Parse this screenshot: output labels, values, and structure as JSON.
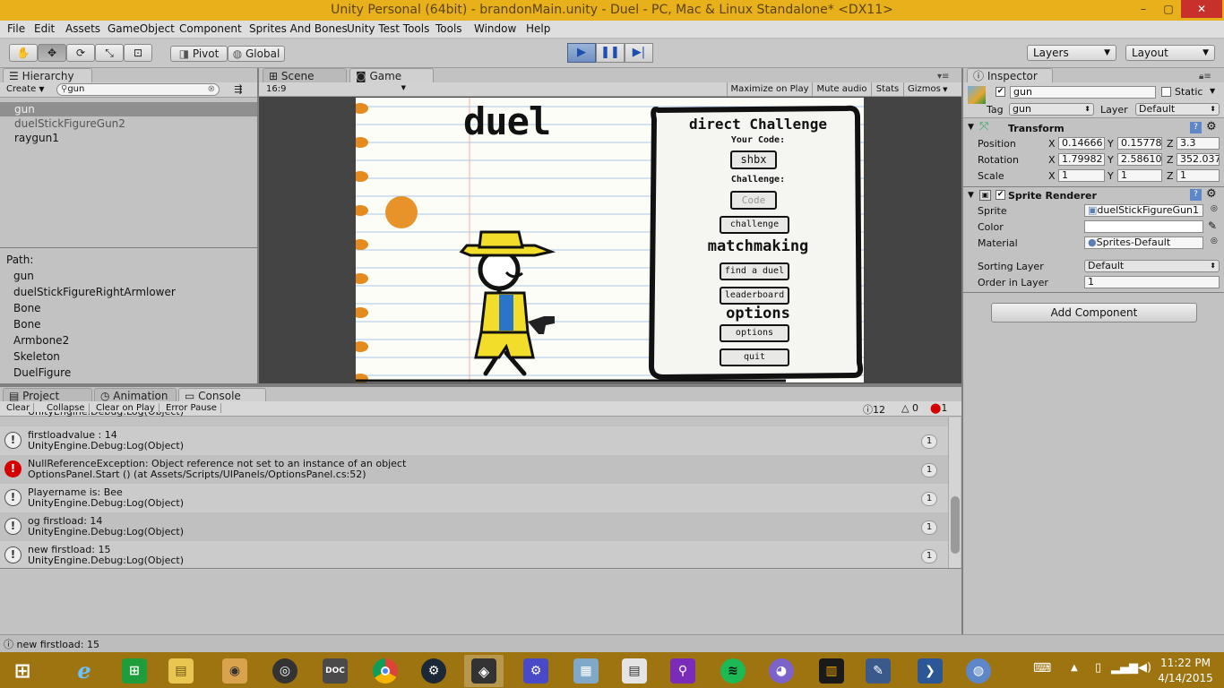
{
  "window": {
    "title": "Unity Personal (64bit) - brandonMain.unity - Duel - PC, Mac & Linux Standalone* <DX11>",
    "minimize": "–",
    "maximize": "▢",
    "close": "✕"
  },
  "menu": [
    "File",
    "Edit",
    "Assets",
    "GameObject",
    "Component",
    "Sprites And Bones",
    "Unity Test Tools",
    "Tools",
    "Window",
    "Help"
  ],
  "toolbar": {
    "pivot": "Pivot",
    "global": "Global",
    "layers": "Layers",
    "layout": "Layout"
  },
  "hierarchy": {
    "tab": "Hierarchy",
    "create": "Create",
    "search": "gun",
    "items": [
      "gun",
      "duelStickFigureGun2",
      "raygun1"
    ],
    "path_label": "Path:",
    "path": [
      "gun",
      "duelStickFigureRightArmlower",
      "Bone",
      "Bone",
      "Armbone2",
      "Skeleton",
      "DuelFigure"
    ]
  },
  "scene": {
    "tab_scene": "Scene",
    "tab_game": "Game",
    "aspect": "16:9",
    "maximize": "Maximize on Play",
    "mute": "Mute audio",
    "stats": "Stats",
    "gizmos": "Gizmos"
  },
  "game": {
    "logo": "duel",
    "panel_title": "direct Challenge",
    "your_code_label": "Your Code:",
    "code": "shbx",
    "challenge_label": "Challenge:",
    "code_placeholder": "Code",
    "challenge_btn": "challenge",
    "matchmaking": "matchmaking",
    "find_btn": "find a duel",
    "leaderboard_btn": "leaderboard",
    "options_title": "options",
    "options_btn": "options",
    "quit_btn": "quit"
  },
  "inspector": {
    "tab": "Inspector",
    "name": "gun",
    "static_label": "Static",
    "tag_label": "Tag",
    "tag": "gun",
    "layer_label": "Layer",
    "layer": "Default",
    "transform": {
      "title": "Transform",
      "position_label": "Position",
      "rotation_label": "Rotation",
      "scale_label": "Scale",
      "position": {
        "x": "0.14666",
        "y": "0.15778",
        "z": "3.3"
      },
      "rotation": {
        "x": "1.79982",
        "y": "2.58610",
        "z": "352.037"
      },
      "scale": {
        "x": "1",
        "y": "1",
        "z": "1"
      }
    },
    "sprite_renderer": {
      "title": "Sprite Renderer",
      "sprite_label": "Sprite",
      "sprite": "duelStickFigureGun1",
      "color_label": "Color",
      "material_label": "Material",
      "material": "Sprites-Default",
      "sorting_label": "Sorting Layer",
      "sorting": "Default",
      "order_label": "Order in Layer",
      "order": "1"
    },
    "add_component": "Add Component"
  },
  "bottom": {
    "tab_project": "Project",
    "tab_animation": "Animation",
    "tab_console": "Console",
    "clear": "Clear",
    "collapse": "Collapse",
    "clear_on_play": "Clear on Play",
    "error_pause": "Error Pause",
    "count_logs": "12",
    "count_warnings": "0",
    "count_errors": "1",
    "partial": "UnityEngine.Debug:Log(Object)",
    "entries": [
      {
        "type": "log",
        "line1": "firstloadvalue : 14",
        "line2": "UnityEngine.Debug:Log(Object)",
        "count": "1"
      },
      {
        "type": "error",
        "line1": "NullReferenceException: Object reference not set to an instance of an object",
        "line2": "OptionsPanel.Start () (at Assets/Scripts/UIPanels/OptionsPanel.cs:52)",
        "count": "1"
      },
      {
        "type": "log",
        "line1": "Playername is: Bee",
        "line2": "UnityEngine.Debug:Log(Object)",
        "count": "1"
      },
      {
        "type": "log",
        "line1": "og firstload: 14",
        "line2": "UnityEngine.Debug:Log(Object)",
        "count": "1"
      },
      {
        "type": "log",
        "line1": "new firstload: 15",
        "line2": "UnityEngine.Debug:Log(Object)",
        "count": "1"
      }
    ],
    "status": "new firstload: 15"
  },
  "taskbar": {
    "time": "11:22 PM",
    "date": "4/14/2015"
  },
  "colors": {
    "titlebar": "#e8b11c",
    "taskbar": "#9e7411",
    "close": "#c7302b",
    "play_active": "#6f8fc2",
    "error": "#d40000",
    "hat": "#f2de2a",
    "vest": "#2a74c9",
    "orange": "#e48a1e"
  }
}
